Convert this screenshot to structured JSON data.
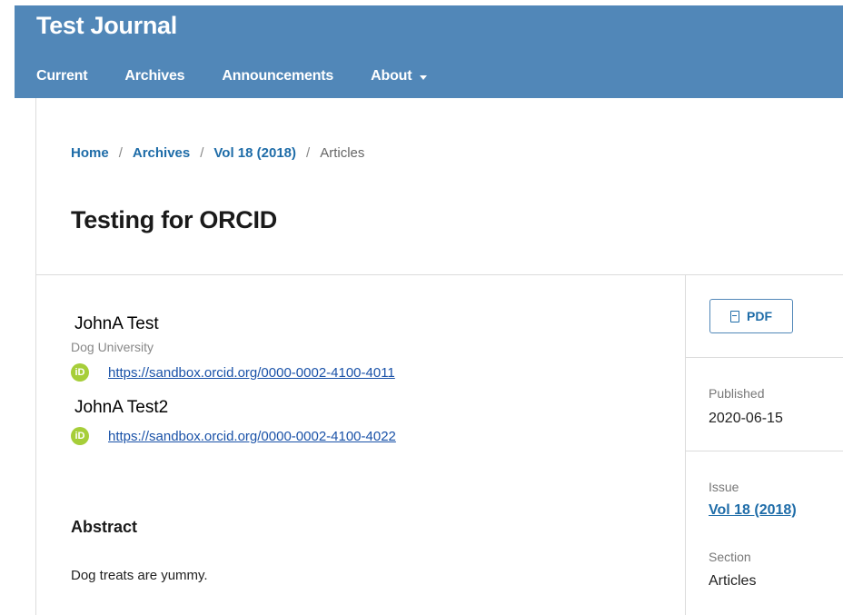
{
  "header": {
    "site_title": "Test Journal",
    "nav": {
      "current": "Current",
      "archives": "Archives",
      "announcements": "Announcements",
      "about": "About"
    }
  },
  "breadcrumb": {
    "home": "Home",
    "archives": "Archives",
    "volume": "Vol 18 (2018)",
    "current": "Articles",
    "separator": "/"
  },
  "article": {
    "title": "Testing for ORCID",
    "authors": [
      {
        "name": "JohnA Test",
        "affiliation": "Dog University",
        "orcid": "https://sandbox.orcid.org/0000-0002-4100-4011"
      },
      {
        "name": "JohnA Test2",
        "orcid": "https://sandbox.orcid.org/0000-0002-4100-4022"
      }
    ],
    "abstract_heading": "Abstract",
    "abstract_text": "Dog treats are yummy."
  },
  "sidebar": {
    "pdf_label": "PDF",
    "published_label": "Published",
    "published_value": "2020-06-15",
    "issue_label": "Issue",
    "issue_value": "Vol 18 (2018)",
    "section_label": "Section",
    "section_value": "Articles"
  },
  "icons": {
    "orcid": "orcid-icon",
    "pdf": "pdf-file-icon",
    "about_caret": "chevron-down-icon"
  },
  "colors": {
    "header_bg": "#5187b8",
    "link": "#1e6ca8",
    "orcid_green": "#a6ce39"
  }
}
